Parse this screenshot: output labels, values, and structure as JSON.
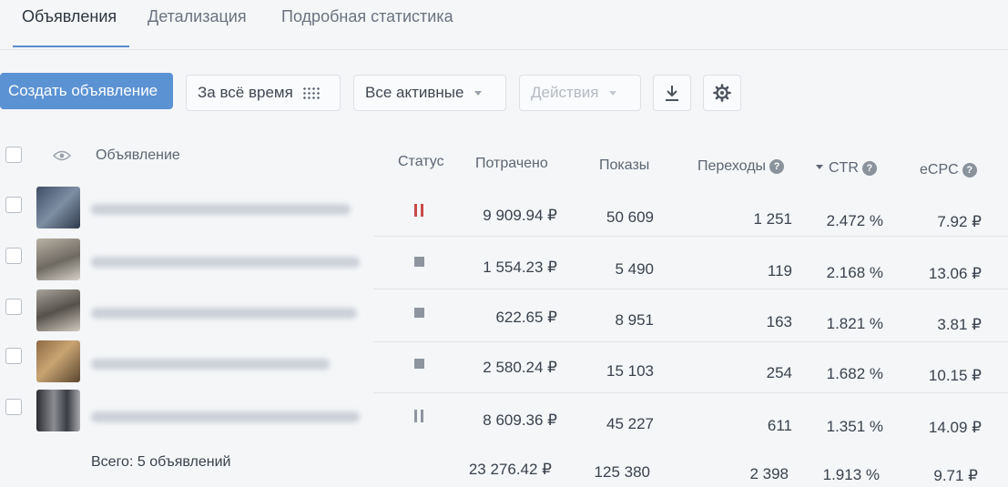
{
  "tabs": [
    {
      "label": "Объявления"
    },
    {
      "label": "Детализация"
    },
    {
      "label": "Подробная статистика"
    }
  ],
  "toolbar": {
    "create_label": "Создать объявление",
    "period_label": "За всё время",
    "filter_label": "Все активные",
    "actions_label": "Действия"
  },
  "table": {
    "headers": {
      "ad": "Объявление",
      "status": "Статус",
      "spent": "Потрачено",
      "impressions": "Показы",
      "clicks": "Переходы",
      "ctr": "CTR",
      "ecpc": "eCPC"
    },
    "rows": [
      {
        "status": "paused-red",
        "spent": "9 909.94 ₽",
        "impressions": "50 609",
        "clicks": "1 251",
        "ctr": "2.472 %",
        "ecpc": "7.92 ₽"
      },
      {
        "status": "stopped",
        "spent": "1 554.23 ₽",
        "impressions": "5 490",
        "clicks": "119",
        "ctr": "2.168 %",
        "ecpc": "13.06 ₽"
      },
      {
        "status": "stopped",
        "spent": "622.65 ₽",
        "impressions": "8 951",
        "clicks": "163",
        "ctr": "1.821 %",
        "ecpc": "3.81 ₽"
      },
      {
        "status": "stopped",
        "spent": "2 580.24 ₽",
        "impressions": "15 103",
        "clicks": "254",
        "ctr": "1.682 %",
        "ecpc": "10.15 ₽"
      },
      {
        "status": "paused-grey",
        "spent": "8 609.36 ₽",
        "impressions": "45 227",
        "clicks": "611",
        "ctr": "1.351 %",
        "ecpc": "14.09 ₽"
      }
    ],
    "totals": {
      "label": "Всего: 5 объявлений",
      "spent": "23 276.42 ₽",
      "impressions": "125 380",
      "clicks": "2 398",
      "ctr": "1.913 %",
      "ecpc": "9.71 ₽"
    }
  },
  "colors": {
    "accent": "#5b92d3",
    "status_paused_active": "#c94a4a",
    "status_inactive": "#8e959e"
  }
}
